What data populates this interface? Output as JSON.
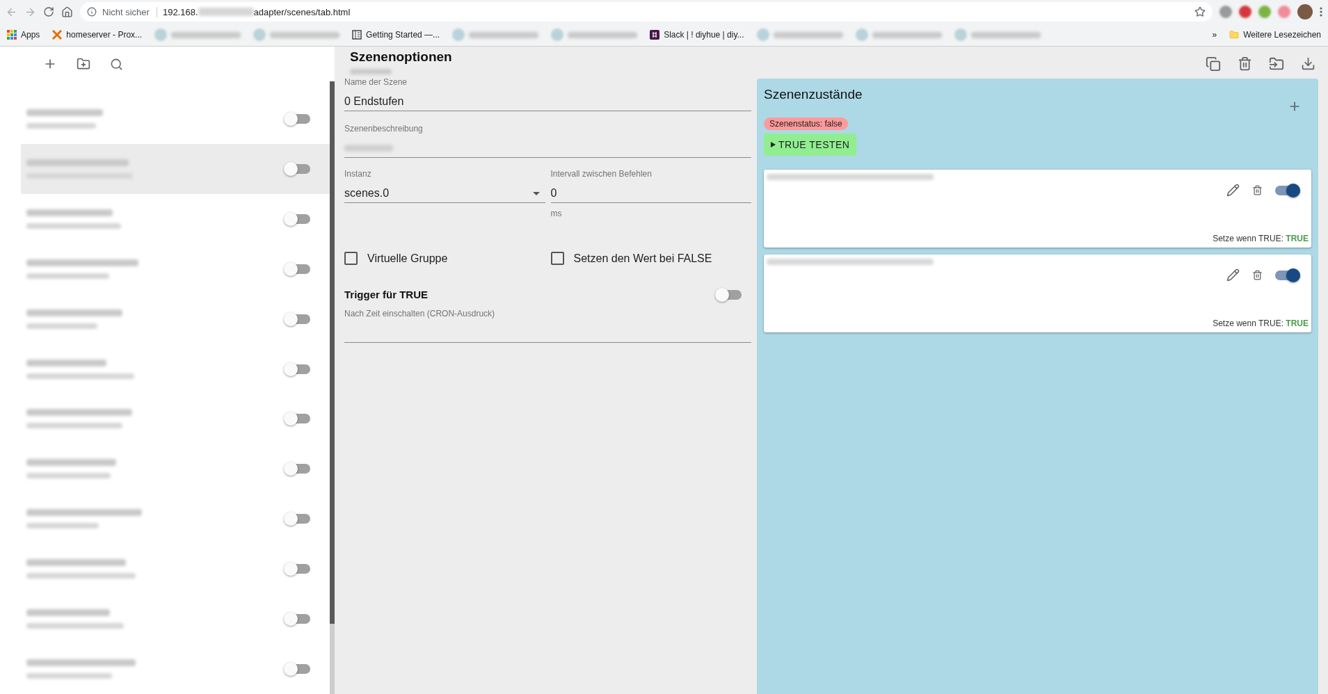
{
  "browser": {
    "security": "Nicht sicher",
    "url_start": "192.168.",
    "url_end": "adapter/scenes/tab.html"
  },
  "bookmarks": [
    {
      "kind": "apps",
      "label": "Apps"
    },
    {
      "kind": "proxmox",
      "label": "homeserver - Prox..."
    },
    {
      "kind": "blurred"
    },
    {
      "kind": "blurred"
    },
    {
      "kind": "book",
      "label": "Getting Started —..."
    },
    {
      "kind": "blurred"
    },
    {
      "kind": "blurred"
    },
    {
      "kind": "slack",
      "label": "Slack | ! diyhue | diy..."
    },
    {
      "kind": "blurred"
    },
    {
      "kind": "blurred"
    },
    {
      "kind": "blurred"
    }
  ],
  "bookmarks_more": "»",
  "other_bookmarks": "Weitere Lesezeichen",
  "sidebar": {
    "items": [
      {
        "selected": false,
        "on": false
      },
      {
        "selected": true,
        "on": false
      },
      {
        "selected": false,
        "on": false
      },
      {
        "selected": false,
        "on": false
      },
      {
        "selected": false,
        "on": false
      },
      {
        "selected": false,
        "on": false
      },
      {
        "selected": false,
        "on": false
      },
      {
        "selected": false,
        "on": false
      },
      {
        "selected": false,
        "on": false
      },
      {
        "selected": false,
        "on": false
      },
      {
        "selected": false,
        "on": false
      },
      {
        "selected": false,
        "on": false
      }
    ]
  },
  "options": {
    "title": "Szenenoptionen",
    "name_label": "Name der Szene",
    "name_value": "0 Endstufen",
    "description_label": "Szenenbeschreibung",
    "instance_label": "Instanz",
    "instance_value": "scenes.0",
    "interval_label": "Intervall zwischen Befehlen",
    "interval_value": "0",
    "interval_unit": "ms",
    "checkboxes": [
      {
        "label": "Virtuelle Gruppe",
        "checked": false
      },
      {
        "label": "Setzen den Wert bei FALSE",
        "checked": false
      }
    ],
    "trigger_title": "Trigger für TRUE",
    "trigger_on": false,
    "cron_label": "Nach Zeit einschalten (CRON-Ausdruck)"
  },
  "states": {
    "title": "Szenenzustände",
    "status": "Szenenstatus: false",
    "test_button": "TRUE TESTEN",
    "items": [
      {
        "enabled": true,
        "set_label": "Setze wenn TRUE:",
        "set_value": "TRUE"
      },
      {
        "enabled": true,
        "set_label": "Setze wenn TRUE:",
        "set_value": "TRUE"
      }
    ]
  }
}
